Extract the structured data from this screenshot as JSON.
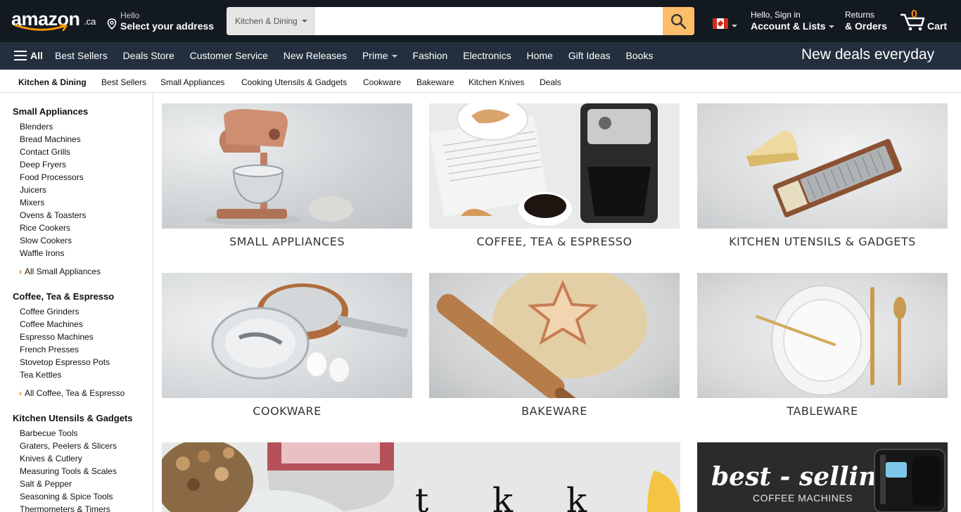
{
  "header": {
    "logo_text": "amazon",
    "logo_tld": ".ca",
    "address_line1": "Hello",
    "address_line2": "Select your address",
    "search_category": "Kitchen & Dining",
    "search_placeholder": "",
    "account_line1": "Hello, Sign in",
    "account_line2": "Account & Lists",
    "returns_line1": "Returns",
    "returns_line2": "& Orders",
    "cart_count": "0",
    "cart_label": "Cart",
    "colors": {
      "nav_bg": "#131921",
      "nav_secondary": "#232f3e",
      "search_button": "#febd69",
      "cart_count": "#f08804"
    }
  },
  "main_nav": {
    "all_label": "All",
    "links": [
      "Best Sellers",
      "Deals Store",
      "Customer Service",
      "New Releases",
      "Prime",
      "Fashion",
      "Electronics",
      "Home",
      "Gift Ideas",
      "Books"
    ],
    "promo": "New deals everyday"
  },
  "sub_nav": {
    "items": [
      "Kitchen & Dining",
      "Best Sellers",
      "Small Appliances",
      "Cooking Utensils & Gadgets",
      "Cookware",
      "Bakeware",
      "Kitchen Knives",
      "Deals"
    ]
  },
  "sidebar": {
    "sections": [
      {
        "title": "Small Appliances",
        "items": [
          "Blenders",
          "Bread Machines",
          "Contact Grills",
          "Deep Fryers",
          "Food Processors",
          "Juicers",
          "Mixers",
          "Ovens & Toasters",
          "Rice Cookers",
          "Slow Cookers",
          "Waffle Irons"
        ],
        "all_link": "All Small Appliances"
      },
      {
        "title": "Coffee, Tea & Espresso",
        "items": [
          "Coffee Grinders",
          "Coffee Machines",
          "Espresso Machines",
          "French Presses",
          "Stovetop Espresso Pots",
          "Tea Kettles"
        ],
        "all_link": "All Coffee, Tea & Espresso"
      },
      {
        "title": "Kitchen Utensils & Gadgets",
        "items": [
          "Barbecue Tools",
          "Graters, Peelers & Slicers",
          "Knives & Cutlery",
          "Measuring Tools & Scales",
          "Salt & Pepper",
          "Seasoning & Spice Tools",
          "Thermometers & Timers"
        ]
      }
    ]
  },
  "tiles": [
    {
      "caption": "SMALL APPLIANCES",
      "icon": "stand-mixer"
    },
    {
      "caption": "COFFEE, TEA & ESPRESSO",
      "icon": "coffee-maker"
    },
    {
      "caption": "KITCHEN UTENSILS & GADGETS",
      "icon": "cheese-grater"
    },
    {
      "caption": "COOKWARE",
      "icon": "saucepan"
    },
    {
      "caption": "BAKEWARE",
      "icon": "rolling-pin"
    },
    {
      "caption": "TABLEWARE",
      "icon": "plates"
    }
  ],
  "promos": {
    "storage_icon": "food-storage-containers",
    "coffee_title": "best - selling",
    "coffee_sub": "COFFEE MACHINES"
  }
}
